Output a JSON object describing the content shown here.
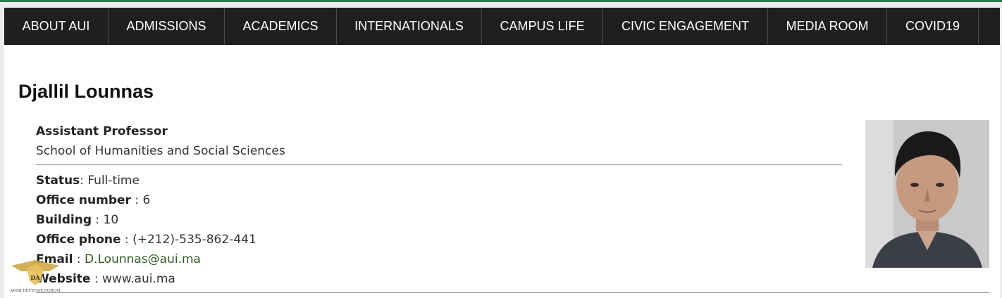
{
  "nav": {
    "items": [
      {
        "label": "ABOUT AUI"
      },
      {
        "label": "ADMISSIONS"
      },
      {
        "label": "ACADEMICS"
      },
      {
        "label": "INTERNATIONALS"
      },
      {
        "label": "CAMPUS LIFE"
      },
      {
        "label": "CIVIC ENGAGEMENT"
      },
      {
        "label": "MEDIA ROOM"
      },
      {
        "label": "COVID19"
      }
    ]
  },
  "profile": {
    "name": "Djallil Lounnas",
    "title": "Assistant Professor",
    "school": "School of Humanities and Social Sciences",
    "status_label": "Status",
    "status_value": ": Full-time",
    "office_number_label": "Office number",
    "office_number_value": " : 6",
    "building_label": "Building",
    "building_value": " : 10",
    "office_phone_label": "Office phone",
    "office_phone_value": " : (+212)-535-862-441",
    "email_label": "Email",
    "email_sep": " : ",
    "email_value": "D.Lounnas@aui.ma",
    "website_label": "Website",
    "website_value": " : www.aui.ma"
  },
  "photo": {
    "icon": "person-portrait"
  },
  "watermark": {
    "text": "ARAB DEFENSE FORUM",
    "initials": "DA"
  },
  "colors": {
    "nav_bg": "#1f1f1f",
    "nav_text": "#ffffff",
    "accent_green": "#2e7d4a",
    "email_link": "#2b5d1e",
    "page_bg": "#ffffff",
    "outer_bg": "#ececec"
  }
}
